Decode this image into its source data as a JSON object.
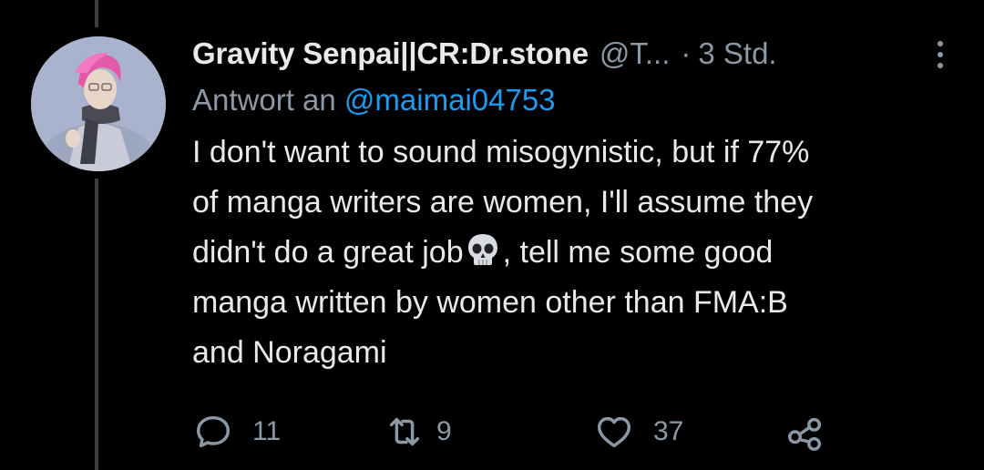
{
  "tweet": {
    "display_name": "Gravity Senpai||CR:Dr.stone",
    "handle": "@T...",
    "separator": "·",
    "time": "3 Std.",
    "reply_prefix": "Antwort an",
    "reply_mention": "@maimai04753",
    "text_lines": [
      "I don't want to sound misogynistic, but if 77%",
      "of manga writers are women, I'll assume they",
      "didn't do a great job",
      ", tell me some good",
      "manga written by women other than FMA:B",
      "and Noragami"
    ],
    "emoji": "skull"
  },
  "actions": {
    "replies": "11",
    "retweets": "9",
    "likes": "37"
  },
  "icons": {
    "reply": "reply-icon",
    "retweet": "retweet-icon",
    "like": "heart-icon",
    "share": "share-icon",
    "more": "more-options-icon"
  },
  "colors": {
    "background": "#000000",
    "text": "#e7e9ea",
    "secondary": "#8b98a5",
    "link": "#1d9bf0",
    "thread_line": "#3a3d41"
  }
}
